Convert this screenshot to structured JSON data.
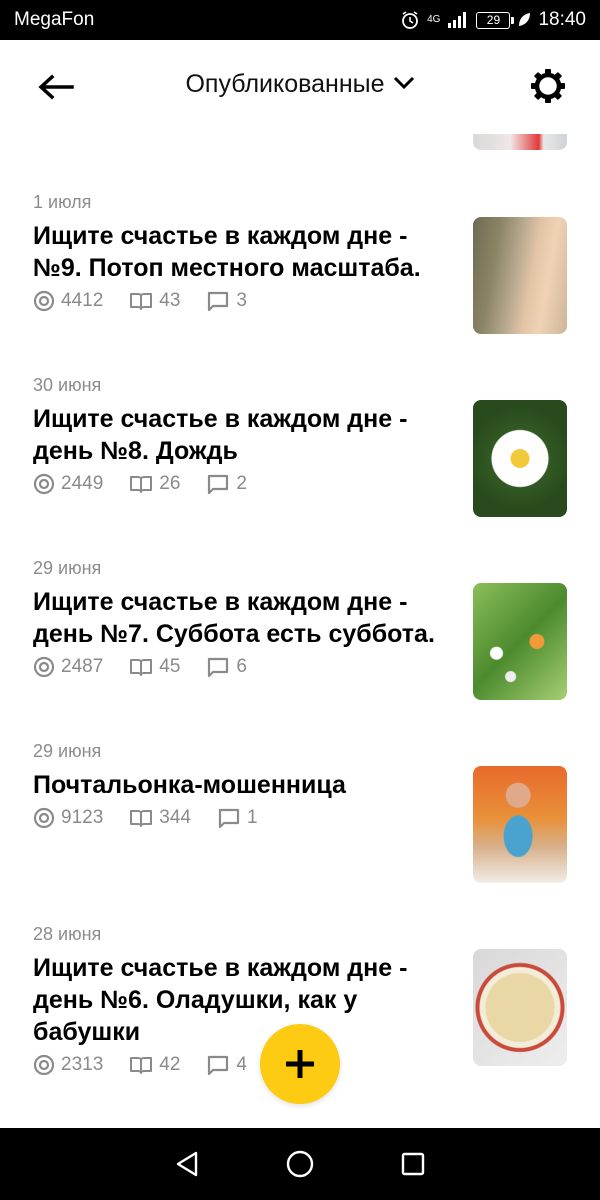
{
  "status_bar": {
    "carrier": "MegaFon",
    "network": "4G",
    "battery": "29",
    "time": "18:40"
  },
  "header": {
    "title": "Опубликованные",
    "icons": {
      "back": "arrow-left-icon",
      "dropdown": "chevron-down-icon",
      "settings": "gear-icon"
    }
  },
  "posts": [
    {
      "date": "1 июля",
      "title": "Ищите счастье в каждом дне - №9. Потоп местного масштаба.",
      "views": "4412",
      "reads": "43",
      "comments": "3",
      "thumb": "water-boards-photo"
    },
    {
      "date": "30 июня",
      "title": "Ищите счастье в каждом дне - день №8. Дождь",
      "views": "2449",
      "reads": "26",
      "comments": "2",
      "thumb": "white-flower-photo"
    },
    {
      "date": "29 июня",
      "title": "Ищите счастье в каждом дне - день №7. Суббота есть суббота.",
      "views": "2487",
      "reads": "45",
      "comments": "6",
      "thumb": "butterfly-photo"
    },
    {
      "date": "29 июня",
      "title": "Почтальонка-мошенница",
      "views": "9123",
      "reads": "344",
      "comments": "1",
      "thumb": "postman-figurine-photo"
    },
    {
      "date": "28 июня",
      "title": "Ищите счастье в каждом дне - день №6. Оладушки, как у бабушки",
      "views": "2313",
      "reads": "42",
      "comments": "4",
      "thumb": "pancakes-photo"
    }
  ],
  "fab": {
    "icon": "plus-icon",
    "color": "#fccb12"
  },
  "nav_bar": {
    "icons": [
      "back-triangle-icon",
      "home-circle-icon",
      "recents-square-icon"
    ]
  }
}
